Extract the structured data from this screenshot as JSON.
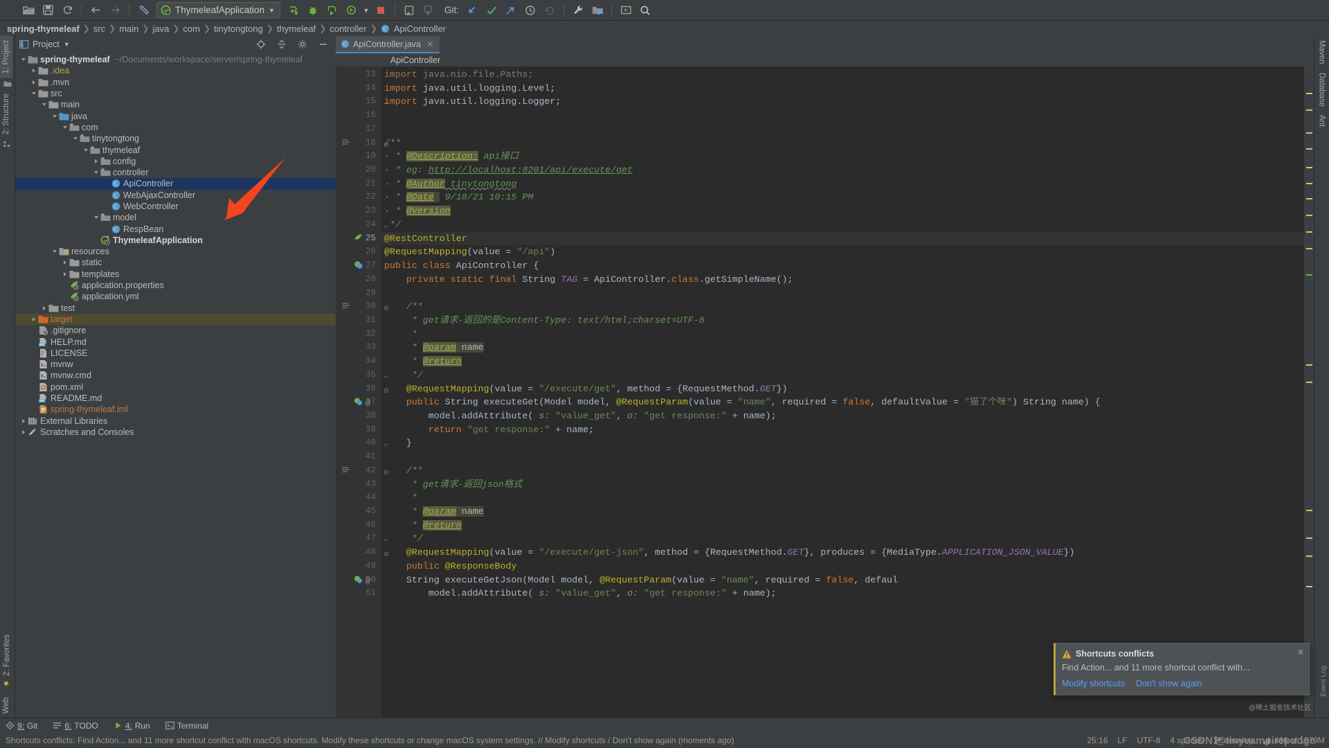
{
  "toolbar": {
    "run_config": "ThymeleafApplication",
    "git_label": "Git:",
    "buttons": [
      "open-project",
      "save-all",
      "sync",
      "back",
      "forward",
      "jump-last-edit",
      "build",
      "debug-run",
      "run-with-coverage",
      "profile",
      "stop",
      "device-manager",
      "download-updates",
      "update-project",
      "commit",
      "push",
      "rollback",
      "settings",
      "project-structure",
      "run-anything",
      "search-everywhere"
    ]
  },
  "breadcrumb": {
    "items": [
      "spring-thymeleaf",
      "src",
      "main",
      "java",
      "com",
      "tinytongtong",
      "thymeleaf",
      "controller",
      "ApiController"
    ]
  },
  "project_panel": {
    "title": "Project",
    "tree": [
      {
        "depth": 0,
        "toggle": "open",
        "icon": "module",
        "label": "spring-thymeleaf",
        "sub": "~/Documents/workspace/server/spring-thymeleaf",
        "style": "bold"
      },
      {
        "depth": 1,
        "toggle": "closed",
        "icon": "folder",
        "label": ".idea",
        "style": "yellow"
      },
      {
        "depth": 1,
        "toggle": "closed",
        "icon": "folder",
        "label": ".mvn"
      },
      {
        "depth": 1,
        "toggle": "open",
        "icon": "folder",
        "label": "src"
      },
      {
        "depth": 2,
        "toggle": "open",
        "icon": "folder",
        "label": "main"
      },
      {
        "depth": 3,
        "toggle": "open",
        "icon": "srcfolder",
        "label": "java"
      },
      {
        "depth": 4,
        "toggle": "open",
        "icon": "package",
        "label": "com"
      },
      {
        "depth": 5,
        "toggle": "open",
        "icon": "package",
        "label": "tinytongtong"
      },
      {
        "depth": 6,
        "toggle": "open",
        "icon": "package",
        "label": "thymeleaf"
      },
      {
        "depth": 7,
        "toggle": "closed",
        "icon": "package",
        "label": "config"
      },
      {
        "depth": 7,
        "toggle": "open",
        "icon": "package",
        "label": "controller"
      },
      {
        "depth": 8,
        "toggle": "none",
        "icon": "class",
        "label": "ApiController",
        "selected": true
      },
      {
        "depth": 8,
        "toggle": "none",
        "icon": "class",
        "label": "WebAjaxController"
      },
      {
        "depth": 8,
        "toggle": "none",
        "icon": "class",
        "label": "WebController"
      },
      {
        "depth": 7,
        "toggle": "open",
        "icon": "package",
        "label": "model"
      },
      {
        "depth": 8,
        "toggle": "none",
        "icon": "class",
        "label": "RespBean"
      },
      {
        "depth": 7,
        "toggle": "none",
        "icon": "springboot",
        "label": "ThymeleafApplication",
        "style": "bold"
      },
      {
        "depth": 3,
        "toggle": "open",
        "icon": "resources",
        "label": "resources"
      },
      {
        "depth": 4,
        "toggle": "closed",
        "icon": "folder",
        "label": "static"
      },
      {
        "depth": 4,
        "toggle": "closed",
        "icon": "folder",
        "label": "templates"
      },
      {
        "depth": 4,
        "toggle": "none",
        "icon": "springcfg",
        "label": "application.properties"
      },
      {
        "depth": 4,
        "toggle": "none",
        "icon": "springcfg",
        "label": "application.yml"
      },
      {
        "depth": 2,
        "toggle": "closed",
        "icon": "folder",
        "label": "test"
      },
      {
        "depth": 1,
        "toggle": "closed",
        "icon": "folder-o",
        "label": "target",
        "style": "orange",
        "highlight": true
      },
      {
        "depth": 1,
        "toggle": "none",
        "icon": "gitignore",
        "label": ".gitignore"
      },
      {
        "depth": 1,
        "toggle": "none",
        "icon": "markdown",
        "label": "HELP.md"
      },
      {
        "depth": 1,
        "toggle": "none",
        "icon": "file",
        "label": "LICENSE"
      },
      {
        "depth": 1,
        "toggle": "none",
        "icon": "shell",
        "label": "mvnw"
      },
      {
        "depth": 1,
        "toggle": "none",
        "icon": "shell",
        "label": "mvnw.cmd"
      },
      {
        "depth": 1,
        "toggle": "none",
        "icon": "maven",
        "label": "pom.xml"
      },
      {
        "depth": 1,
        "toggle": "none",
        "icon": "markdown",
        "label": "README.md"
      },
      {
        "depth": 1,
        "toggle": "none",
        "icon": "iml",
        "label": "spring-thymeleaf.iml",
        "style": "orange"
      },
      {
        "depth": 0,
        "toggle": "closed",
        "icon": "libs",
        "label": "External Libraries"
      },
      {
        "depth": 0,
        "toggle": "closed",
        "icon": "scratches",
        "label": "Scratches and Consoles"
      }
    ]
  },
  "left_strip": {
    "tabs": [
      "1: Project",
      "2: Structure",
      "2: Favorites",
      "Web"
    ]
  },
  "right_strip": {
    "tabs": [
      "Maven",
      "Database",
      "Ant"
    ]
  },
  "editor": {
    "tab_label": "ApiController.java",
    "sticky_header": "ApiController",
    "first_line": 13,
    "lines": [
      {
        "n": 13,
        "html": "<span class=\"kw\" style=\"color:#9a7351\">import</span> <span style=\"color:#7c7c7c\">java.nio.file.Paths;</span>"
      },
      {
        "n": 14,
        "html": "<span class=\"kw\">import</span> java.util.logging.Level;"
      },
      {
        "n": 15,
        "html": "<span class=\"kw\">import</span> java.util.logging.Logger;",
        "fold": "end"
      },
      {
        "n": 16,
        "html": ""
      },
      {
        "n": 17,
        "html": ""
      },
      {
        "n": 18,
        "html": "<span class=\"cmt\">/**</span>",
        "fold": "start",
        "bookmark": "indent"
      },
      {
        "n": 19,
        "html": "<span class=\"cmtg\">·</span><span class=\"cmt\"> * </span><span class=\"tagn-hl\">@Description:</span><span class=\"cmt\"> api接口</span>"
      },
      {
        "n": 20,
        "html": "<span class=\"cmtg\">·</span><span class=\"cmt\"> * eg: </span><span class=\"link\">http://localhost:8201/api/execute/get</span>"
      },
      {
        "n": 21,
        "html": "<span class=\"cmtg\">·</span><span class=\"cmt\"> * </span><span class=\"tagn-hl\">@Author</span><span class=\"cmt wavy\"> tinytongtong</span>"
      },
      {
        "n": 22,
        "html": "<span class=\"cmtg\">·</span><span class=\"cmt\"> * </span><span class=\"tagn-hl\">@Date</span><span class=\"hlbg2\"> </span><span class=\"cmt\"> 9/18/21 10:15 PM</span>"
      },
      {
        "n": 23,
        "html": "<span class=\"cmtg\">·</span><span class=\"cmt\"> * </span><span class=\"tagn-hl\">@Version</span>"
      },
      {
        "n": 24,
        "html": "<span class=\"cmt\"> */</span>",
        "fold": "end"
      },
      {
        "n": 25,
        "html": "<span class=\"ann\">@RestController</span>",
        "gicon": "spring-bean",
        "fold": "start"
      },
      {
        "n": 26,
        "html": "<span class=\"ann\">@RequestMapping</span>(value = <span class=\"str\">\"/api\"</span>)",
        "fold": "mid"
      },
      {
        "n": 27,
        "html": "<span class=\"kw\">public class</span> ApiController {",
        "gicon": "spring-class"
      },
      {
        "n": 28,
        "html": "    <span class=\"kw\">private static final</span> String <span class=\"field\">TAG</span> = ApiController.<span class=\"kw\">class</span>.getSimpleName();"
      },
      {
        "n": 29,
        "html": ""
      },
      {
        "n": 30,
        "html": "    <span class=\"cmt\">/**</span>",
        "fold": "start",
        "bookmark": "indent"
      },
      {
        "n": 31,
        "html": "     <span class=\"cmt\">* get请求-返回的是Content-Type: text/html;charset=UTF-8</span>"
      },
      {
        "n": 32,
        "html": "     <span class=\"cmt\">*</span>"
      },
      {
        "n": 33,
        "html": "     <span class=\"cmt\">* </span><span class=\"tagn-hl\">@param</span><span class=\"hlbg2\"> name</span>"
      },
      {
        "n": 34,
        "html": "     <span class=\"cmt\">* </span><span class=\"tagn-hl\">@return</span>"
      },
      {
        "n": 35,
        "html": "     <span class=\"cmt\">*/</span>",
        "fold": "end"
      },
      {
        "n": 36,
        "html": "    <span class=\"ann\">@RequestMapping</span>(value = <span class=\"str\">\"/execute/get\"</span>, method = {RequestMethod.<span class=\"field\">GET</span>})",
        "fold": "start"
      },
      {
        "n": 37,
        "html": "    <span class=\"kw\">public</span> String executeGet(Model model, <span class=\"ann\">@RequestParam</span>(value = <span class=\"str\">\"name\"</span>, required = <span class=\"kw\">false</span>, defaultValue = <span class=\"str\">\"猫了个咪\"</span>) String name) {",
        "gicon": "spring-url",
        "gicon2": "at"
      },
      {
        "n": 38,
        "html": "        model.addAttribute( <span class=\"cparam\">s:</span> <span class=\"str\">\"value_get\"</span>, <span class=\"cparam\">o:</span> <span class=\"str\">\"get response:\"</span> + name);"
      },
      {
        "n": 39,
        "html": "        <span class=\"kw\">return</span> <span class=\"str\">\"get response:\"</span> + name;"
      },
      {
        "n": 40,
        "html": "    }",
        "fold": "end"
      },
      {
        "n": 41,
        "html": ""
      },
      {
        "n": 42,
        "html": "    <span class=\"cmt\">/**</span>",
        "fold": "start",
        "bookmark": "indent"
      },
      {
        "n": 43,
        "html": "     <span class=\"cmt\">* get请求-返回json格式</span>"
      },
      {
        "n": 44,
        "html": "     <span class=\"cmt\">*</span>"
      },
      {
        "n": 45,
        "html": "     <span class=\"cmt\">* </span><span class=\"tagn-hl\">@param</span><span class=\"hlbg2\"> name</span>"
      },
      {
        "n": 46,
        "html": "     <span class=\"cmt\">* </span><span class=\"tagn-hl\">@return</span>"
      },
      {
        "n": 47,
        "html": "     <span class=\"cmt\">*/</span>",
        "fold": "end"
      },
      {
        "n": 48,
        "html": "    <span class=\"ann\">@RequestMapping</span>(value = <span class=\"str\">\"/execute/get-json\"</span>, method = {RequestMethod.<span class=\"field\">GET</span>}, produces = {MediaType.<span class=\"field\">APPLICATION_JSON_VALUE</span>})",
        "fold": "start"
      },
      {
        "n": 49,
        "html": "    <span class=\"kw\">public</span> <span class=\"ann\">@ResponseBody</span>"
      },
      {
        "n": 50,
        "html": "    String executeGetJson(Model model, <span class=\"ann\">@RequestParam</span>(value = <span class=\"str\">\"name\"</span>, required = <span class=\"kw\">false</span>, defaul",
        "gicon": "spring-url",
        "gicon2": "at"
      },
      {
        "n": 51,
        "html": "        model.addAttribute( <span class=\"cparam\">s:</span> <span class=\"str\">\"value_get\"</span>, <span class=\"cparam\">o:</span> <span class=\"str\">\"get response:\"</span> + name);"
      }
    ]
  },
  "notification": {
    "title": "Shortcuts conflicts",
    "body": "Find Action... and 11 more shortcut conflict with...",
    "action_primary": "Modify shortcuts",
    "action_secondary": "Don't show again"
  },
  "bottom_bar": {
    "items": [
      {
        "num": "9:",
        "label": "Git",
        "icon": "git-icon"
      },
      {
        "num": "6:",
        "label": "TODO",
        "icon": "todo-icon"
      },
      {
        "num": "4:",
        "label": "Run",
        "icon": "run-icon"
      },
      {
        "num": "",
        "label": "Terminal",
        "icon": "terminal-icon"
      }
    ]
  },
  "status_bar": {
    "message": "Shortcuts conflicts: Find Action... and 11 more shortcut conflict with macOS shortcuts. Modify these shortcuts or change macOS system settings. // Modify shortcuts / Don't show again (moments ago)",
    "caret": "25:16",
    "line_sep": "LF",
    "encoding": "UTF-8",
    "indent": "4 spaces",
    "branch": "develop",
    "memory": "466 of 1979M"
  },
  "watermarks": {
    "main": "CSDN @tinyvampirepudge",
    "small": "@稀土掘金技术社区",
    "event_log": "Event Log"
  },
  "colors": {
    "accent_blue": "#4a88c7",
    "selection": "#1c3561",
    "warning": "#bba53d",
    "annotation_arrow": "#f4451e",
    "panel_bg": "#3c3f41",
    "editor_bg": "#2b2b2b",
    "gutter_bg": "#313335"
  }
}
